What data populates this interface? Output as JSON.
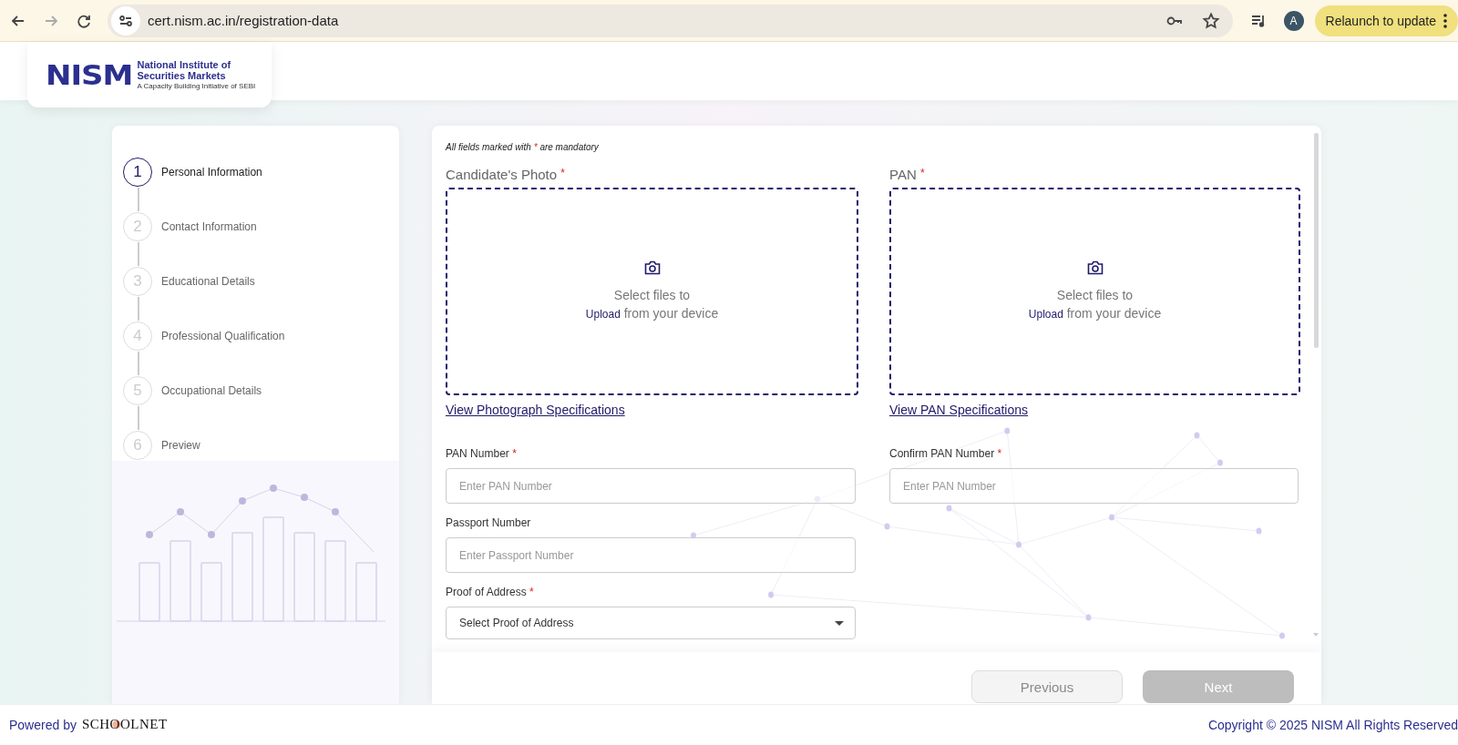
{
  "browser": {
    "url": "cert.nism.ac.in/registration-data",
    "profile_initial": "A",
    "update_button": "Relaunch to update"
  },
  "logo": {
    "mark": "NISM",
    "name_line1": "National Institute of",
    "name_line2": "Securities Markets",
    "tagline": "A Capacity Building Initiative of SEBI"
  },
  "steps": [
    {
      "number": "1",
      "label": "Personal Information",
      "selected": true
    },
    {
      "number": "2",
      "label": "Contact Information",
      "selected": false
    },
    {
      "number": "3",
      "label": "Educational Details",
      "selected": false
    },
    {
      "number": "4",
      "label": "Professional Qualification",
      "selected": false
    },
    {
      "number": "5",
      "label": "Occupational Details",
      "selected": false
    },
    {
      "number": "6",
      "label": "Preview",
      "selected": false
    }
  ],
  "form": {
    "note": [
      "All fields marked with ",
      "*",
      " are mandatory"
    ],
    "uploads": [
      {
        "label": "Candidate's Photo",
        "required_mark": "*",
        "line1": "Select files to",
        "upload_word": "Upload",
        "line2": "from your device",
        "link": "View Photograph Specifications"
      },
      {
        "label": "PAN",
        "required_mark": "*",
        "line1": "Select files to",
        "upload_word": "Upload",
        "line2": "from your device",
        "link": "View PAN Specifications"
      }
    ],
    "rows": [
      [
        {
          "kind": "text",
          "label": "PAN Number",
          "required_mark": "*",
          "placeholder": "Enter PAN Number"
        },
        {
          "kind": "text",
          "label": "Confirm PAN Number",
          "required_mark": "*",
          "placeholder": "Enter PAN Number"
        }
      ],
      [
        {
          "kind": "text",
          "label": "Passport Number",
          "placeholder": "Enter Passport Number"
        }
      ],
      [
        {
          "kind": "select",
          "label": "Proof of Address",
          "required_mark": "*",
          "placeholder": "Select Proof of Address"
        }
      ]
    ],
    "buttons": [
      {
        "label": "Previous",
        "kind": "secondary",
        "disabled": true
      },
      {
        "label": "Next",
        "kind": "primary",
        "disabled": true
      }
    ]
  },
  "footer": {
    "powered_by": "Powered by",
    "brand": "SCHOOLNET",
    "copyright": "Copyright © 2025 NISM All Rights Reserved"
  }
}
